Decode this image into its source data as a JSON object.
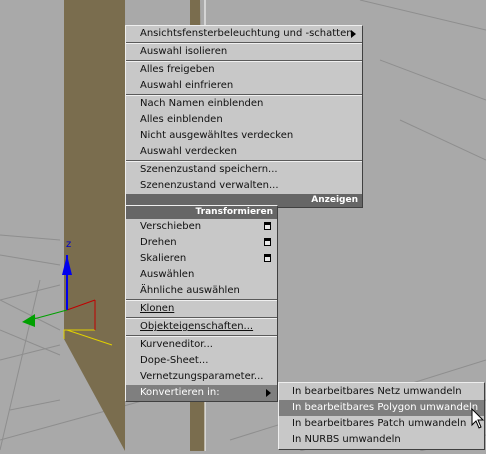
{
  "display_menu": {
    "items": [
      {
        "label": "Ansichtsfensterbeleuchtung und -schatten",
        "submenu": true
      },
      {
        "sep": true
      },
      {
        "label": "Auswahl isolieren"
      },
      {
        "sep": true
      },
      {
        "label": "Alles freigeben"
      },
      {
        "label": "Auswahl einfrieren"
      },
      {
        "sep": true
      },
      {
        "label": "Nach Namen einblenden"
      },
      {
        "label": "Alles einblenden"
      },
      {
        "label": "Nicht ausgewähltes verdecken"
      },
      {
        "label": "Auswahl verdecken"
      },
      {
        "sep": true
      },
      {
        "label": "Szenenzustand speichern..."
      },
      {
        "label": "Szenenzustand verwalten..."
      }
    ],
    "footer_label": "Anzeigen"
  },
  "transform_menu": {
    "header_label": "Transformieren",
    "items": [
      {
        "label": "Verschieben",
        "settings": true
      },
      {
        "label": "Drehen",
        "settings": true
      },
      {
        "label": "Skalieren",
        "settings": true
      },
      {
        "label": "Auswählen"
      },
      {
        "label": "Ähnliche auswählen"
      },
      {
        "sep": true
      },
      {
        "label": "Klonen"
      },
      {
        "sep": true
      },
      {
        "label": "Objekteigenschaften..."
      },
      {
        "sep": true
      },
      {
        "label": "Kurveneditor..."
      },
      {
        "label": "Dope-Sheet..."
      },
      {
        "label": "Vernetzungsparameter..."
      },
      {
        "label": "Konvertieren in:",
        "submenu": true,
        "highlighted": true
      }
    ]
  },
  "convert_submenu": {
    "items": [
      {
        "label": "In bearbeitbares Netz umwandeln"
      },
      {
        "label": "In bearbeitbares Polygon umwandeln",
        "highlighted": true
      },
      {
        "label": "In bearbeitbares Patch umwandeln"
      },
      {
        "label": "In NURBS umwandeln"
      }
    ]
  },
  "gizmo": {
    "z_axis_label": "z"
  },
  "colors": {
    "viewport_bg": "#a9a9a9",
    "grid": "#8e8e8e",
    "object_face": "#7a6d4e",
    "menu_bg": "#c8c8c8",
    "menu_header": "#666666",
    "highlight": "#7f7f7f"
  }
}
